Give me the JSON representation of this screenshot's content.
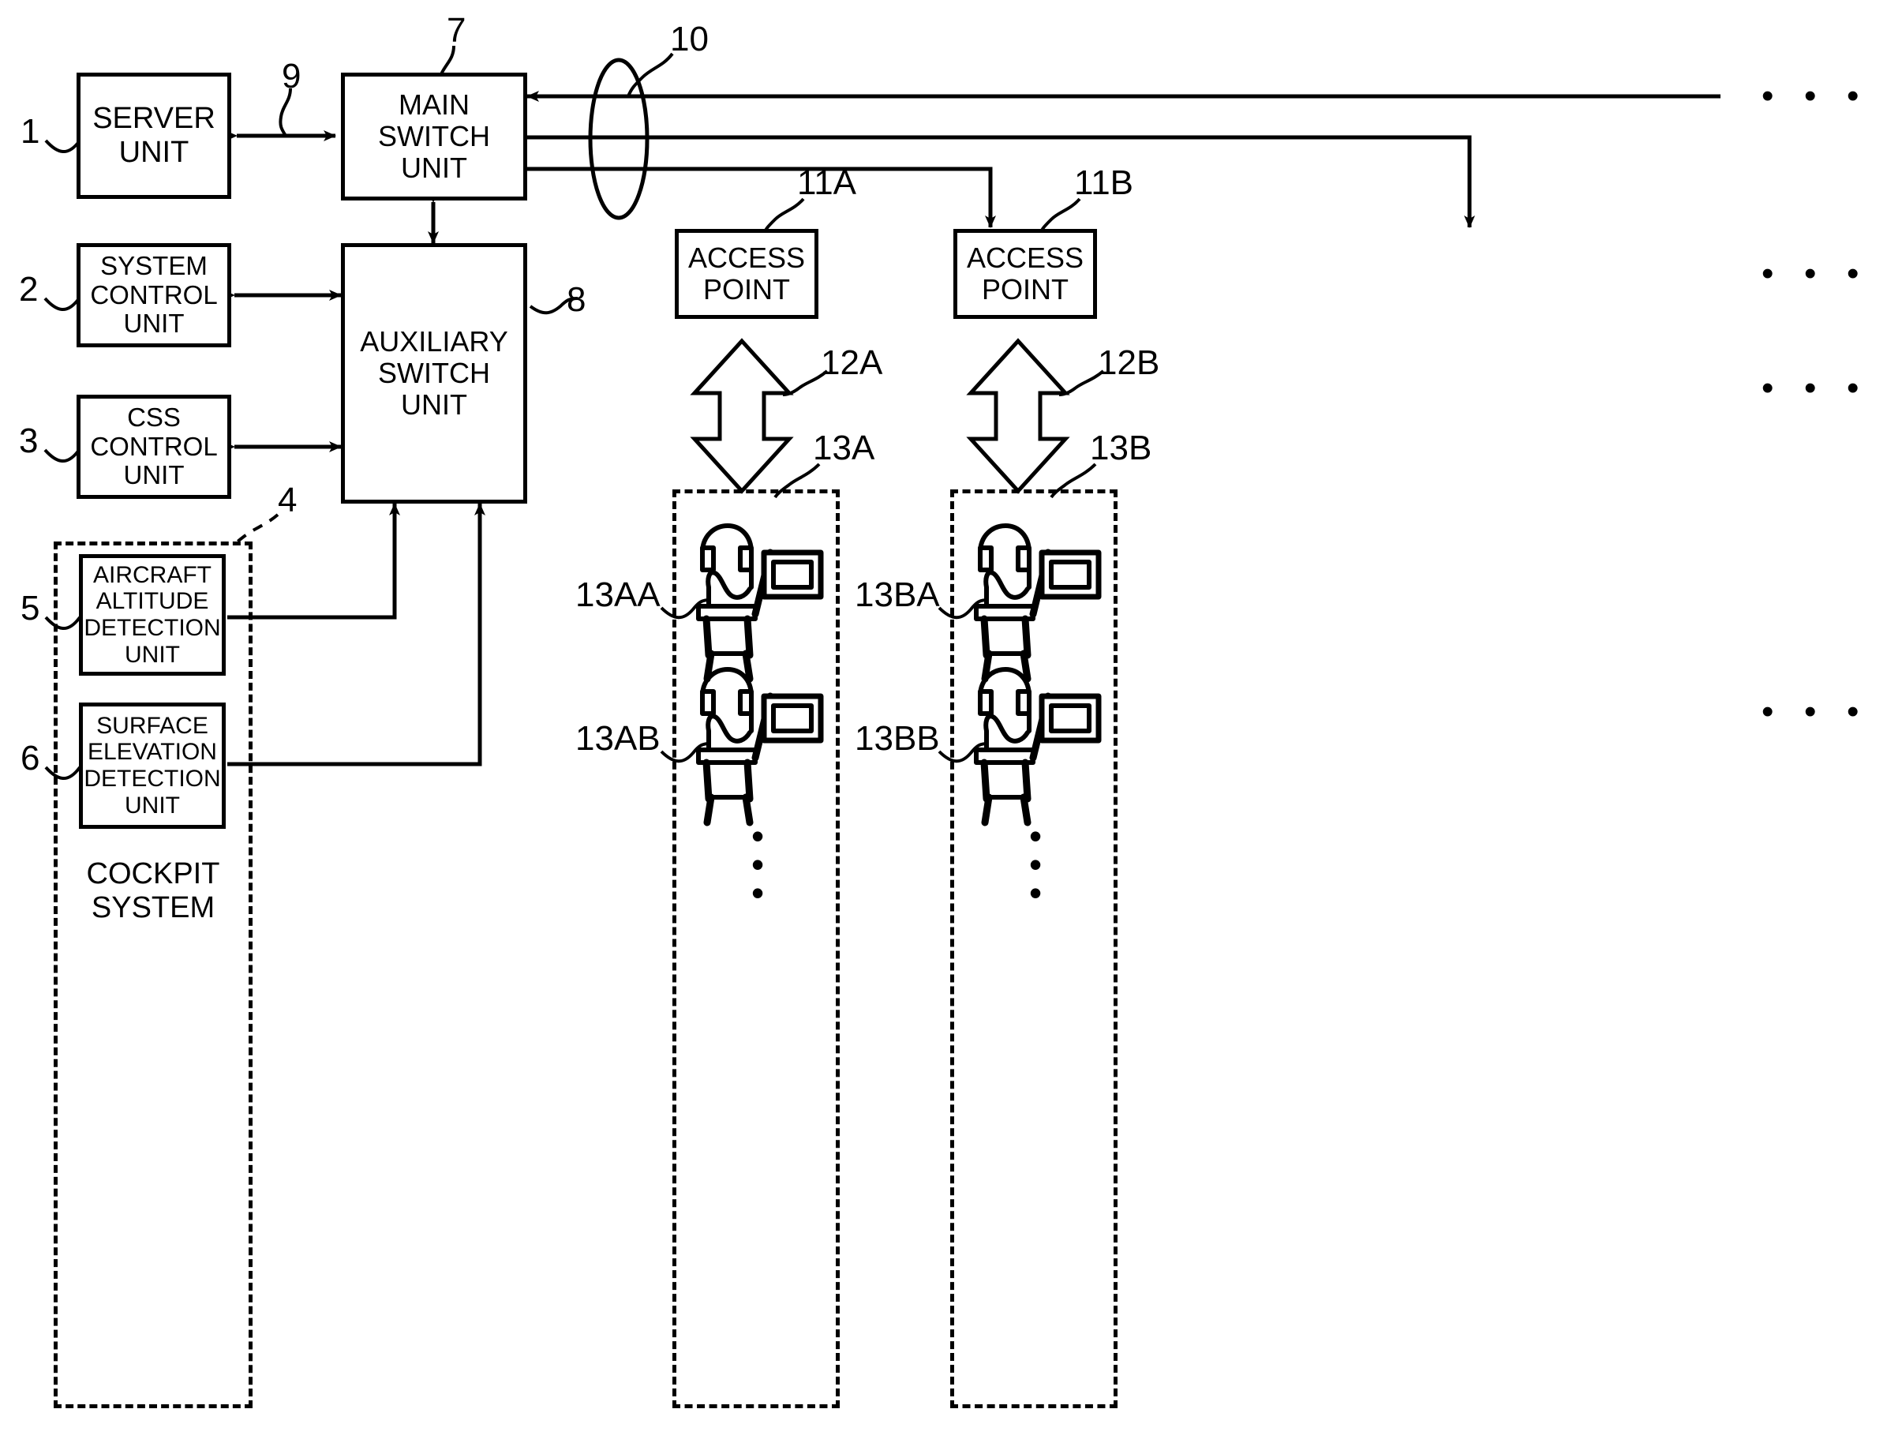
{
  "figure": {
    "title": "Aircraft in-flight entertainment network block diagram",
    "line_color": "#000000",
    "background": "#ffffff"
  },
  "blocks": [
    {
      "id": "server",
      "label": "SERVER\nUNIT",
      "ref": "1"
    },
    {
      "id": "syscontrol",
      "label": "SYSTEM\nCONTROL\nUNIT",
      "ref": "2"
    },
    {
      "id": "csscontrol",
      "label": "CSS\nCONTROL\nUNIT",
      "ref": "3"
    },
    {
      "id": "altitude",
      "label": "AIRCRAFT\nALTITUDE\nDETECTION\nUNIT",
      "ref": "5"
    },
    {
      "id": "surface",
      "label": "SURFACE\nELEVATION\nDETECTION\nUNIT",
      "ref": "6"
    },
    {
      "id": "mainswitch",
      "label": "MAIN SWITCH\nUNIT",
      "ref": "7"
    },
    {
      "id": "auxswitch",
      "label": "AUXILIARY\nSWITCH UNIT",
      "ref": "8"
    },
    {
      "id": "accesspointA",
      "label": "ACCESS\nPOINT",
      "ref": "11A"
    },
    {
      "id": "accesspointB",
      "label": "ACCESS\nPOINT",
      "ref": "11B"
    }
  ],
  "groups": [
    {
      "id": "cockpit",
      "label": "COCKPIT\nSYSTEM",
      "ref": "4"
    },
    {
      "id": "seatgroupA",
      "label": "",
      "ref": "13A"
    },
    {
      "id": "seatgroupB",
      "label": "",
      "ref": "13B"
    }
  ],
  "connections": [
    {
      "id": "server-mainswitch",
      "ref": "9"
    },
    {
      "id": "network-bundle",
      "ref": "10"
    },
    {
      "id": "wirelessA",
      "ref": "12A"
    },
    {
      "id": "wirelessB",
      "ref": "12B"
    }
  ],
  "seats": [
    {
      "id": "seatAA",
      "ref": "13AA",
      "group": "13A"
    },
    {
      "id": "seatAB",
      "ref": "13AB",
      "group": "13A"
    },
    {
      "id": "seatBA",
      "ref": "13BA",
      "group": "13B"
    },
    {
      "id": "seatBB",
      "ref": "13BB",
      "group": "13B"
    }
  ],
  "continuation": {
    "horizontal_dots": "•  •  •",
    "vertical_dots": "•\n•\n•"
  }
}
